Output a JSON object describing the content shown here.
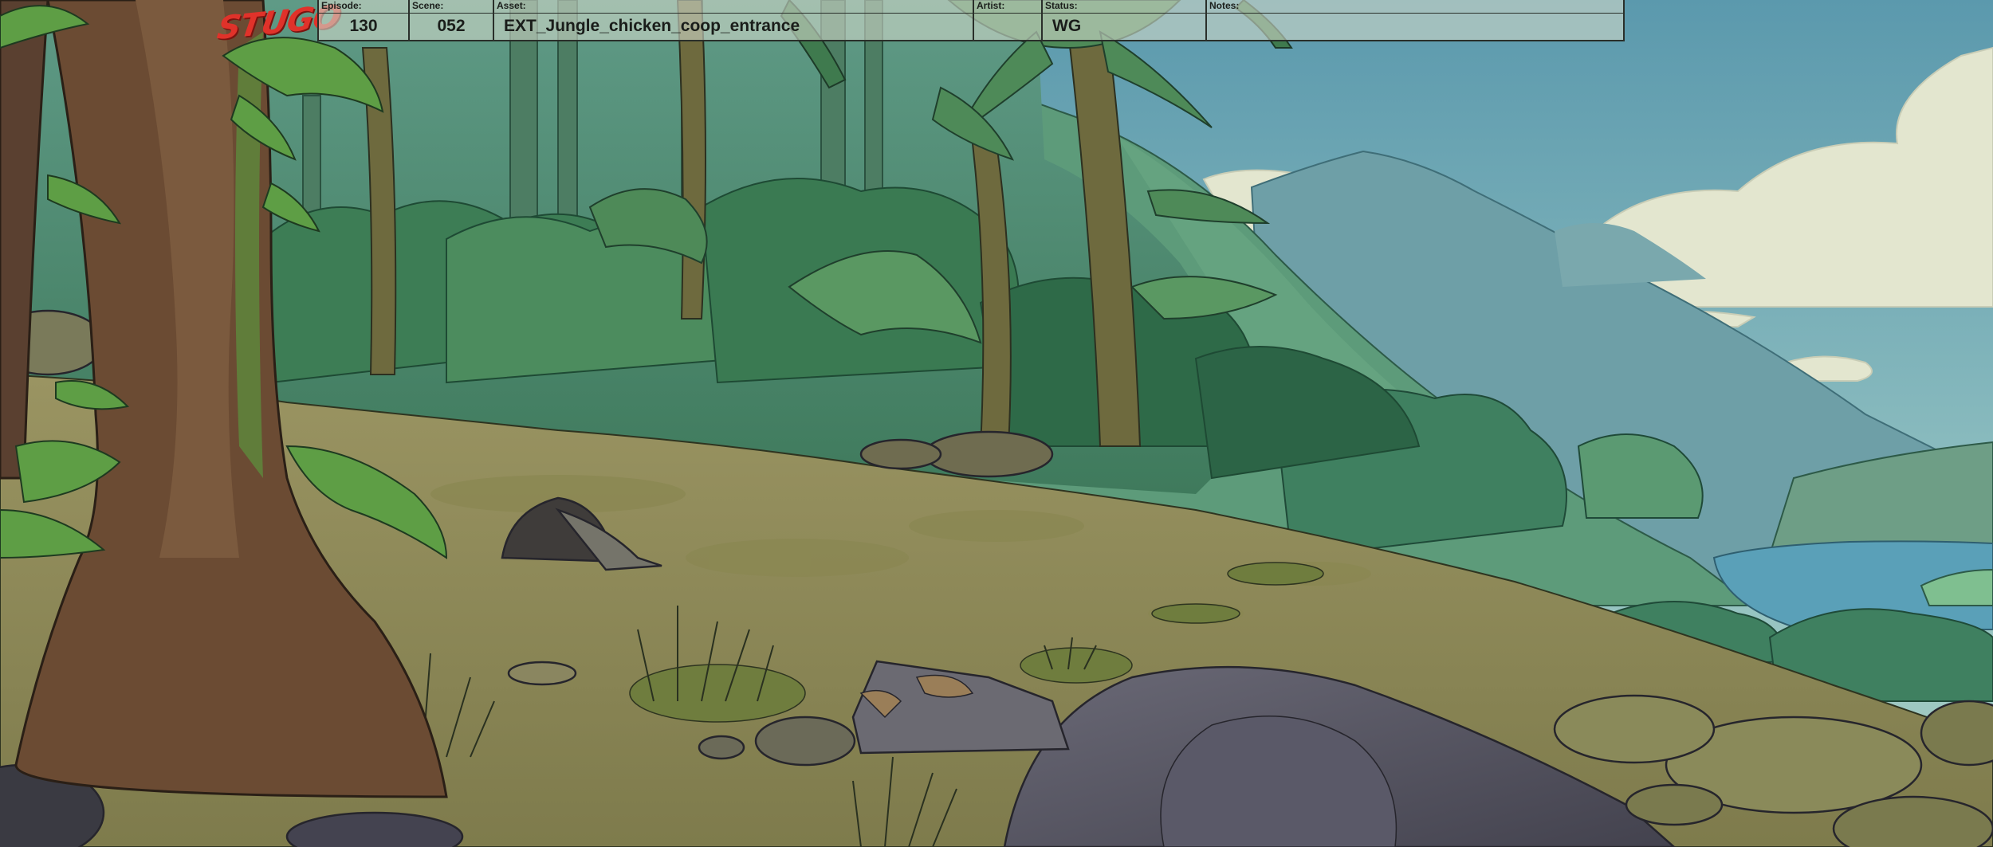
{
  "logo": {
    "text": "STUGO"
  },
  "slate": {
    "episode": {
      "label": "Episode:",
      "value": "130"
    },
    "scene": {
      "label": "Scene:",
      "value": "052"
    },
    "asset": {
      "label": "Asset:",
      "value": "EXT_Jungle_chicken_coop_entrance"
    },
    "artist": {
      "label": "Artist:",
      "value": ""
    },
    "status": {
      "label": "Status:",
      "value": "WG"
    },
    "notes": {
      "label": "Notes:",
      "value": ""
    }
  },
  "colors": {
    "sky_top": "#5f9fb0",
    "sky_bottom": "#9cc6c4",
    "jungle_dark": "#2f6b4e",
    "jungle_mid": "#4f8a5a",
    "ground": "#8f8a58",
    "rock": "#5b5a66",
    "trunk": "#6b4b33",
    "water": "#5aa0b8",
    "logo_red": "#e0322a"
  }
}
